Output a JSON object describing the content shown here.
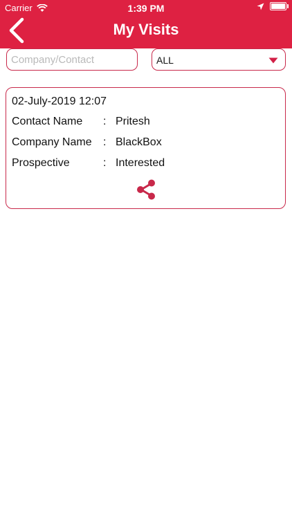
{
  "status_bar": {
    "carrier": "Carrier",
    "time": "1:39 PM"
  },
  "header": {
    "title": "My Visits",
    "back_icon": "chevron-left-icon"
  },
  "filters": {
    "search_placeholder": "Company/Contact",
    "search_value": "",
    "status_selected": "ALL"
  },
  "visits": [
    {
      "datetime": "02-July-2019 12:07",
      "fields": [
        {
          "label": "Contact Name",
          "value": "Pritesh"
        },
        {
          "label": "Company Name",
          "value": "BlackBox"
        },
        {
          "label": "Prospective",
          "value": "Interested"
        }
      ],
      "separator": ":"
    }
  ],
  "colors": {
    "accent": "#de2142",
    "border": "#c8284a",
    "share": "#c8284a"
  }
}
